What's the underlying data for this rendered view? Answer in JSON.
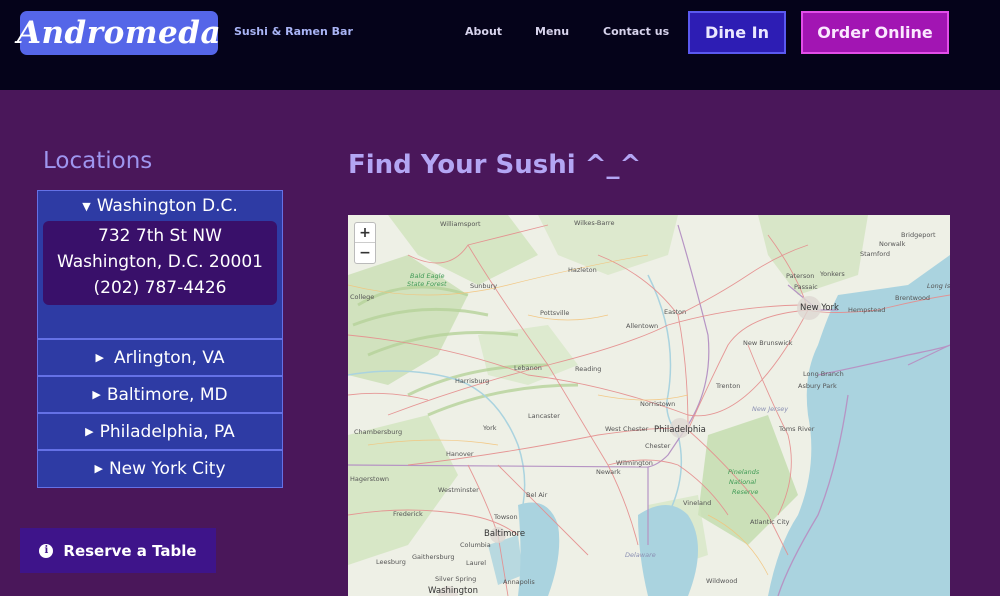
{
  "header": {
    "brand": "Andromeda",
    "tagline": "Sushi & Ramen Bar",
    "nav": [
      "About",
      "Menu",
      "Contact us"
    ],
    "dine_in": "Dine In",
    "order_online": "Order Online"
  },
  "sidebar": {
    "title": "Locations",
    "locations": [
      {
        "name": "Washington D.C.",
        "expanded": true,
        "address1": "732 7th St NW",
        "address2": "Washington, D.C. 20001",
        "phone": "(202) 787-4426"
      },
      {
        "name": "Arlington, VA",
        "expanded": false
      },
      {
        "name": "Baltimore, MD",
        "expanded": false
      },
      {
        "name": "Philadelphia, PA",
        "expanded": false
      },
      {
        "name": "New York City",
        "expanded": false
      }
    ],
    "reserve": "Reserve a Table"
  },
  "main": {
    "title": "Find Your Sushi ^_^",
    "zoom_in": "+",
    "zoom_out": "−",
    "map_labels": {
      "williamsport": "Williamsport",
      "wilkes_barre": "Wilkes-Barre",
      "hazleton": "Hazleton",
      "state_college": "College",
      "bald_eagle": "Bald Eagle",
      "state_forest": "State Forest",
      "sunbury": "Sunbury",
      "pottsville": "Pottsville",
      "allentown": "Allentown",
      "easton": "Easton",
      "lebanon": "Lebanon",
      "reading": "Reading",
      "harrisburg": "Harrisburg",
      "norristown": "Norristown",
      "lancaster": "Lancaster",
      "chambersburg": "Chambersburg",
      "york": "York",
      "west_chester": "West Chester",
      "philadelphia": "Philadelphia",
      "chester": "Chester",
      "hanover": "Hanover",
      "wilmington": "Wilmington",
      "newark": "Newark",
      "hagerstown": "Hagerstown",
      "westminster": "Westminster",
      "bel_air": "Bel Air",
      "frederick": "Frederick",
      "towson": "Towson",
      "baltimore": "Baltimore",
      "columbia": "Columbia",
      "gaithersburg": "Gaithersburg",
      "laurel": "Laurel",
      "leesburg": "Leesburg",
      "silver_spring": "Silver Spring",
      "annapolis": "Annapolis",
      "washington": "Washington",
      "delaware": "Delaware",
      "vineland": "Vineland",
      "pinelands": "Pinelands",
      "national": "National",
      "reserve": "Reserve",
      "atlantic_city": "Atlantic City",
      "wildwood": "Wildwood",
      "new_jersey": "New Jersey",
      "toms_river": "Toms River",
      "long_branch": "Long Branch",
      "asbury_park": "Asbury Park",
      "trenton": "Trenton",
      "new_brunswick": "New Brunswick",
      "new_york": "New York",
      "paterson": "Paterson",
      "yonkers": "Yonkers",
      "passaic": "Passaic",
      "hempstead": "Hempstead",
      "brentwood": "Brentwood",
      "norwalk": "Norwalk",
      "stamford": "Stamford",
      "bridgeport": "Bridgeport",
      "long_island": "Long Island"
    }
  }
}
